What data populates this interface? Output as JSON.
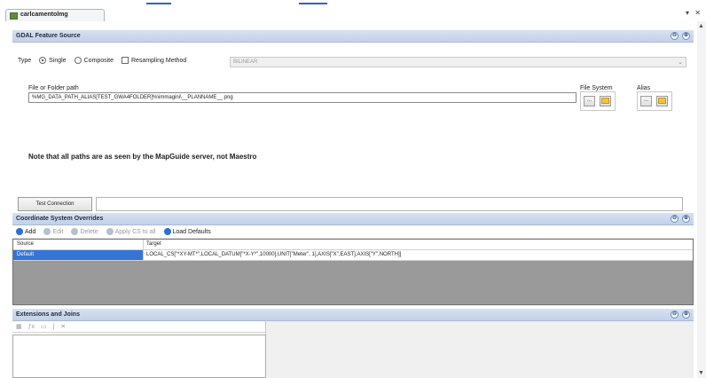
{
  "document_tab": {
    "title": "carlcamentolmg"
  },
  "window_controls": {
    "menu": "▾",
    "close": "✕"
  },
  "feature_source": {
    "header": "GDAL Feature Source",
    "type_label": "Type",
    "single_label": "Single",
    "composite_label": "Composite",
    "resampling_label": "Resampling Method",
    "resampling_value": "BILINEAR",
    "single_selected": true,
    "composite_selected": false,
    "resampling_checked": false,
    "path_label": "File or Folder path",
    "path_value": "%MG_DATA_PATH_ALIAS[TEST_GWA4FOLDER]%\\immagini\\__PLANNAME__.png",
    "file_system_label": "File System",
    "alias_label": "Alias",
    "note": "Note that all paths are as seen by the MapGuide server, not Maestro",
    "test_connection_label": "Test Connection",
    "test_result": ""
  },
  "coord_overrides": {
    "header": "Coordinate System Overrides",
    "toolbar": {
      "add": "Add",
      "edit": "Edit",
      "delete": "Delete",
      "apply_all": "Apply CS to all",
      "load_defaults": "Load Defaults"
    },
    "columns": {
      "source": "Source",
      "target": "Target"
    },
    "rows": [
      {
        "source": "Default",
        "target": "LOCAL_CS[\"*XY-MT*\",LOCAL_DATUM[\"*X-Y*\",10000],UNIT[\"Meter\", 1],AXIS[\"X\",EAST],AXIS[\"Y\",NORTH]]"
      }
    ]
  },
  "extensions": {
    "header": "Extensions and Joins"
  },
  "icons": {
    "collapse": "⊖",
    "expand": "⊕",
    "scroll_up": "▲",
    "scroll_down": "▼",
    "chevron": "⌄",
    "ellipsis": "..."
  },
  "colors": {
    "panel_header": "#c8d6ea",
    "selection": "#3475d6",
    "folder": "#f1c43c"
  }
}
